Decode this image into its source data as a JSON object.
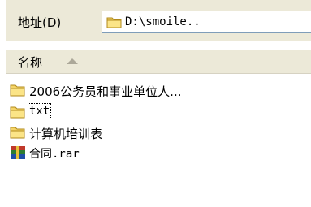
{
  "address": {
    "label_prefix": "地址(",
    "label_key": "D",
    "label_suffix": ")",
    "path": "D:\\smoile.."
  },
  "list_header": {
    "name_column": "名称"
  },
  "files": [
    {
      "label": "2006公务员和事业单位人...",
      "icon": "folder-icon"
    },
    {
      "label": "txt",
      "icon": "folder-icon"
    },
    {
      "label": "计算机培训表",
      "icon": "folder-icon"
    },
    {
      "label": "合同.rar",
      "icon": "winrar-archive-icon"
    }
  ]
}
